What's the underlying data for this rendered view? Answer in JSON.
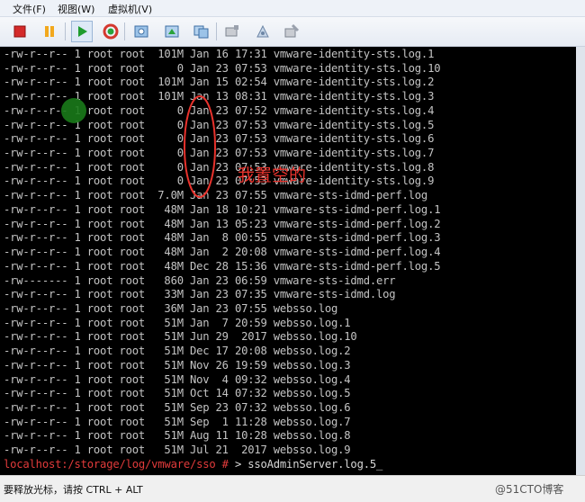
{
  "menu": {
    "file": "文件(F)",
    "view": "视图(W)",
    "vm": "虚拟机(V)"
  },
  "toolbar": {
    "buttons": [
      "stop-icon",
      "pause-icon",
      "play-icon",
      "reset-icon",
      "snapshot-icon",
      "snapshot-restore-icon",
      "snapshot-manager-icon",
      "send-ctrl-alt-del-icon",
      "settings-icon",
      "install-tools-icon"
    ]
  },
  "terminal": {
    "lines": [
      "-rw-r--r-- 1 root root  101M Jan 16 17:31 vmware-identity-sts.log.1",
      "-rw-r--r-- 1 root root     0 Jan 23 07:53 vmware-identity-sts.log.10",
      "-rw-r--r-- 1 root root  101M Jan 15 02:54 vmware-identity-sts.log.2",
      "-rw-r--r-- 1 root root  101M Jan 13 08:31 vmware-identity-sts.log.3",
      "-rw-r--r-- 1 root root     0 Jan 23 07:52 vmware-identity-sts.log.4",
      "-rw-r--r-- 1 root root     0 Jan 23 07:53 vmware-identity-sts.log.5",
      "-rw-r--r-- 1 root root     0 Jan 23 07:53 vmware-identity-sts.log.6",
      "-rw-r--r-- 1 root root     0 Jan 23 07:53 vmware-identity-sts.log.7",
      "-rw-r--r-- 1 root root     0 Jan 23 07:53 vmware-identity-sts.log.8",
      "-rw-r--r-- 1 root root     0 Jan 23 07:53 vmware-identity-sts.log.9",
      "-rw-r--r-- 1 root root  7.0M Jan 23 07:55 vmware-sts-idmd-perf.log",
      "-rw-r--r-- 1 root root   48M Jan 18 10:21 vmware-sts-idmd-perf.log.1",
      "-rw-r--r-- 1 root root   48M Jan 13 05:23 vmware-sts-idmd-perf.log.2",
      "-rw-r--r-- 1 root root   48M Jan  8 00:55 vmware-sts-idmd-perf.log.3",
      "-rw-r--r-- 1 root root   48M Jan  2 20:08 vmware-sts-idmd-perf.log.4",
      "-rw-r--r-- 1 root root   48M Dec 28 15:36 vmware-sts-idmd-perf.log.5",
      "-rw------- 1 root root   860 Jan 23 06:59 vmware-sts-idmd.err",
      "-rw-r--r-- 1 root root   33M Jan 23 07:35 vmware-sts-idmd.log",
      "-rw-r--r-- 1 root root   36M Jan 23 07:55 websso.log",
      "-rw-r--r-- 1 root root   51M Jan  7 20:59 websso.log.1",
      "-rw-r--r-- 1 root root   51M Jun 29  2017 websso.log.10",
      "-rw-r--r-- 1 root root   51M Dec 17 20:08 websso.log.2",
      "-rw-r--r-- 1 root root   51M Nov 26 19:59 websso.log.3",
      "-rw-r--r-- 1 root root   51M Nov  4 09:32 websso.log.4",
      "-rw-r--r-- 1 root root   51M Oct 14 07:32 websso.log.5",
      "-rw-r--r-- 1 root root   51M Sep 23 07:32 websso.log.6",
      "-rw-r--r-- 1 root root   51M Sep  1 11:28 websso.log.7",
      "-rw-r--r-- 1 root root   51M Aug 11 10:28 websso.log.8",
      "-rw-r--r-- 1 root root   51M Jul 21  2017 websso.log.9"
    ],
    "prompt_host": "localhost:/storage/log/vmware/sso # ",
    "prompt_cmd": "> ssoAdminServer.log.5_"
  },
  "annotation": {
    "text": "我置空的",
    "color": "#e8322c"
  },
  "status": {
    "hint": "要释放光标，请按 CTRL + ALT",
    "watermark": "@51CTO博客"
  }
}
